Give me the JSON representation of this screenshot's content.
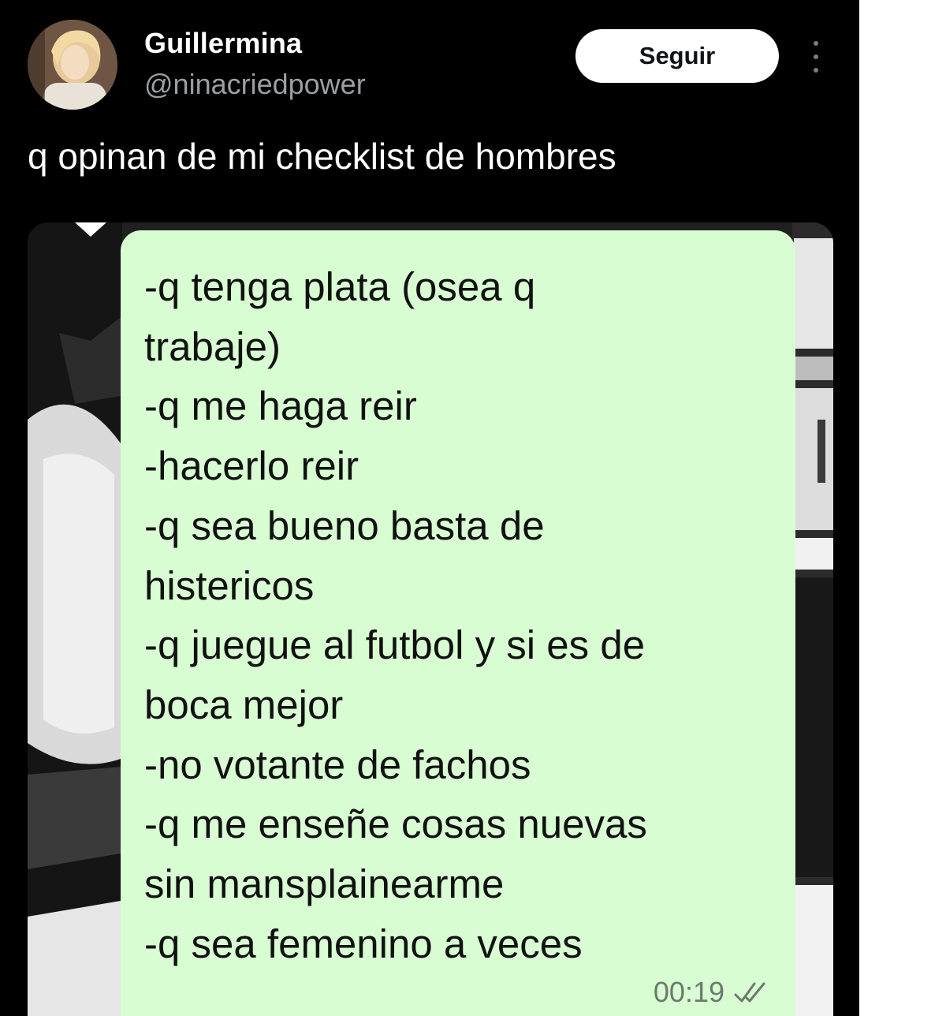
{
  "author": {
    "name": "Guillermina",
    "handle": "@ninacriedpower",
    "avatar_icon": "profile-photo"
  },
  "follow_button": {
    "label": "Seguir"
  },
  "menu": {
    "icon": "more-vertical-icon"
  },
  "tweet": {
    "text": "q opinan de mi checklist de hombres"
  },
  "chat_message": {
    "lines": [
      "-q tenga plata (osea q",
      "trabaje)",
      "-q me haga reir",
      "-hacerlo reir",
      "-q sea bueno basta de",
      "histericos",
      "-q juegue al futbol y si es de",
      "boca mejor",
      "-no votante de fachos",
      "-q me enseñe cosas nuevas",
      "sin mansplainearme",
      "-q sea femenino a veces"
    ],
    "time": "00:19",
    "status_icon": "double-check-icon",
    "bubble_color": "#d8fdd2"
  },
  "colors": {
    "background": "#000000",
    "text": "#ffffff",
    "handle": "#9a9fa5"
  }
}
